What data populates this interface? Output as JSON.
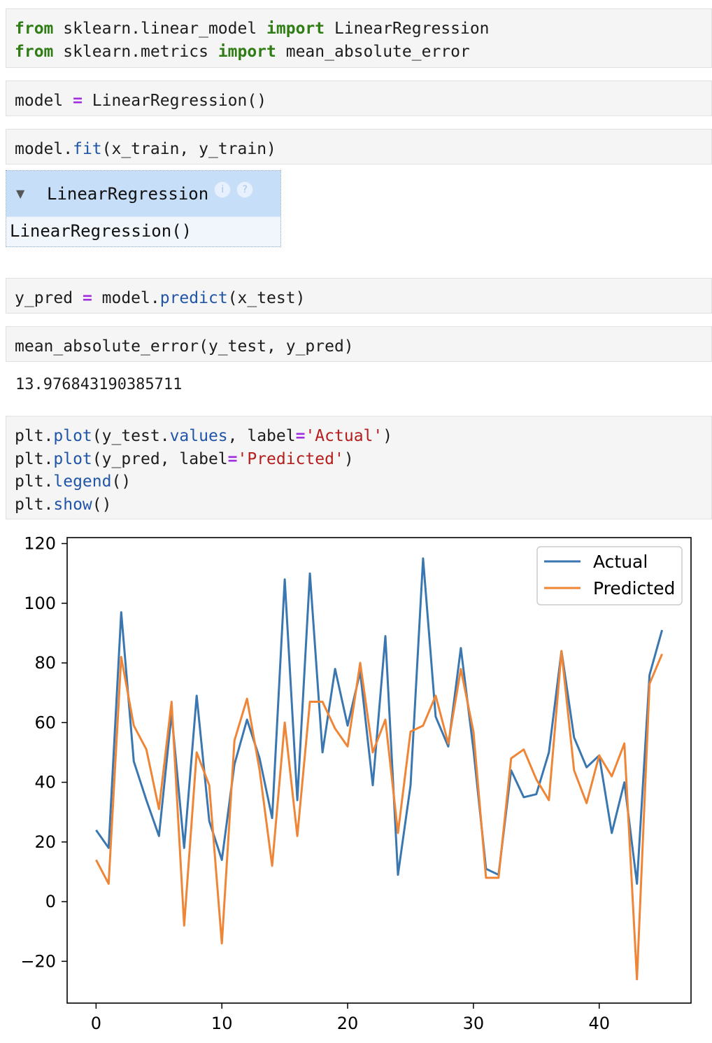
{
  "cells": {
    "imports": {
      "line1": {
        "kw1": "from",
        "mod": " sklearn.linear_model ",
        "kw2": "import",
        "name": " LinearRegression"
      },
      "line2": {
        "kw1": "from",
        "mod": " sklearn.metrics ",
        "kw2": "import",
        "name": " mean_absolute_error"
      }
    },
    "model": {
      "lhs": "model ",
      "op": "=",
      "rhs": " LinearRegression()"
    },
    "fit": {
      "obj": "model.",
      "fn": "fit",
      "args": "(x_train, y_train)"
    },
    "estimator": {
      "arrow": "▼",
      "title": "LinearRegression",
      "info_icon": "i",
      "help_icon": "?",
      "repr": "LinearRegression()"
    },
    "predict": {
      "lhs": "y_pred ",
      "op": "=",
      "obj": " model.",
      "fn": "predict",
      "args": "(x_test)"
    },
    "mae": {
      "code": "mean_absolute_error(y_test, y_pred)",
      "output": "13.976843190385711"
    },
    "plot": {
      "l1": {
        "obj": "plt.",
        "fn": "plot",
        "a": "(y_test.",
        "attr": "values",
        "b": ", label",
        "op": "=",
        "str": "'Actual'",
        "c": ")"
      },
      "l2": {
        "obj": "plt.",
        "fn": "plot",
        "a": "(y_pred, label",
        "op": "=",
        "str": "'Predicted'",
        "c": ")"
      },
      "l3": {
        "obj": "plt.",
        "fn": "legend",
        "c": "()"
      },
      "l4": {
        "obj": "plt.",
        "fn": "show",
        "c": "()"
      }
    }
  },
  "chart_data": {
    "type": "line",
    "xlim": [
      -2.3,
      47.3
    ],
    "ylim": [
      -34,
      122
    ],
    "xticks": [
      0,
      10,
      20,
      30,
      40
    ],
    "yticks": [
      -20,
      0,
      20,
      40,
      60,
      80,
      100,
      120
    ],
    "legend_position": "top-right",
    "series": [
      {
        "name": "Actual",
        "color": "#3a76af",
        "values": [
          24,
          18,
          97,
          47,
          34,
          22,
          63,
          18,
          69,
          27,
          14,
          46,
          61,
          48,
          28,
          108,
          34,
          110,
          50,
          78,
          59,
          77,
          39,
          89,
          9,
          39,
          115,
          62,
          52,
          85,
          51,
          11,
          9,
          44,
          35,
          36,
          50,
          84,
          55,
          45,
          49,
          23,
          40,
          6,
          76,
          91
        ]
      },
      {
        "name": "Predicted",
        "color": "#ef8536",
        "values": [
          14,
          6,
          82,
          59,
          51,
          31,
          67,
          -8,
          50,
          39,
          -14,
          54,
          68,
          44,
          12,
          60,
          22,
          67,
          67,
          58,
          52,
          80,
          50,
          61,
          23,
          57,
          59,
          69,
          53,
          78,
          57,
          8,
          8,
          48,
          51,
          41,
          34,
          84,
          44,
          33,
          49,
          42,
          53,
          -26,
          73,
          83
        ]
      }
    ]
  }
}
